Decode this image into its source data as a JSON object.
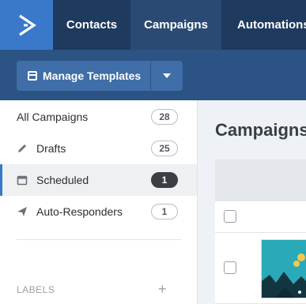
{
  "nav": {
    "tabs": [
      {
        "label": "Contacts",
        "active": false
      },
      {
        "label": "Campaigns",
        "active": true
      },
      {
        "label": "Automations",
        "active": false
      }
    ]
  },
  "toolbar": {
    "manage_templates_label": "Manage Templates"
  },
  "sidebar": {
    "items": [
      {
        "label": "All Campaigns",
        "count": "28",
        "icon": "none"
      },
      {
        "label": "Drafts",
        "count": "25",
        "icon": "pencil-icon"
      },
      {
        "label": "Scheduled",
        "count": "1",
        "icon": "calendar-icon",
        "active": true
      },
      {
        "label": "Auto-Responders",
        "count": "1",
        "icon": "paper-plane-icon"
      }
    ],
    "labels_heading": "LABELS"
  },
  "main": {
    "title": "Campaigns"
  },
  "colors": {
    "topbar": "#1f3a5f",
    "logo": "#3a78c9",
    "subbar": "#2b5383",
    "button": "#3f6ea8",
    "thumbnail": "#2aa9b8"
  }
}
